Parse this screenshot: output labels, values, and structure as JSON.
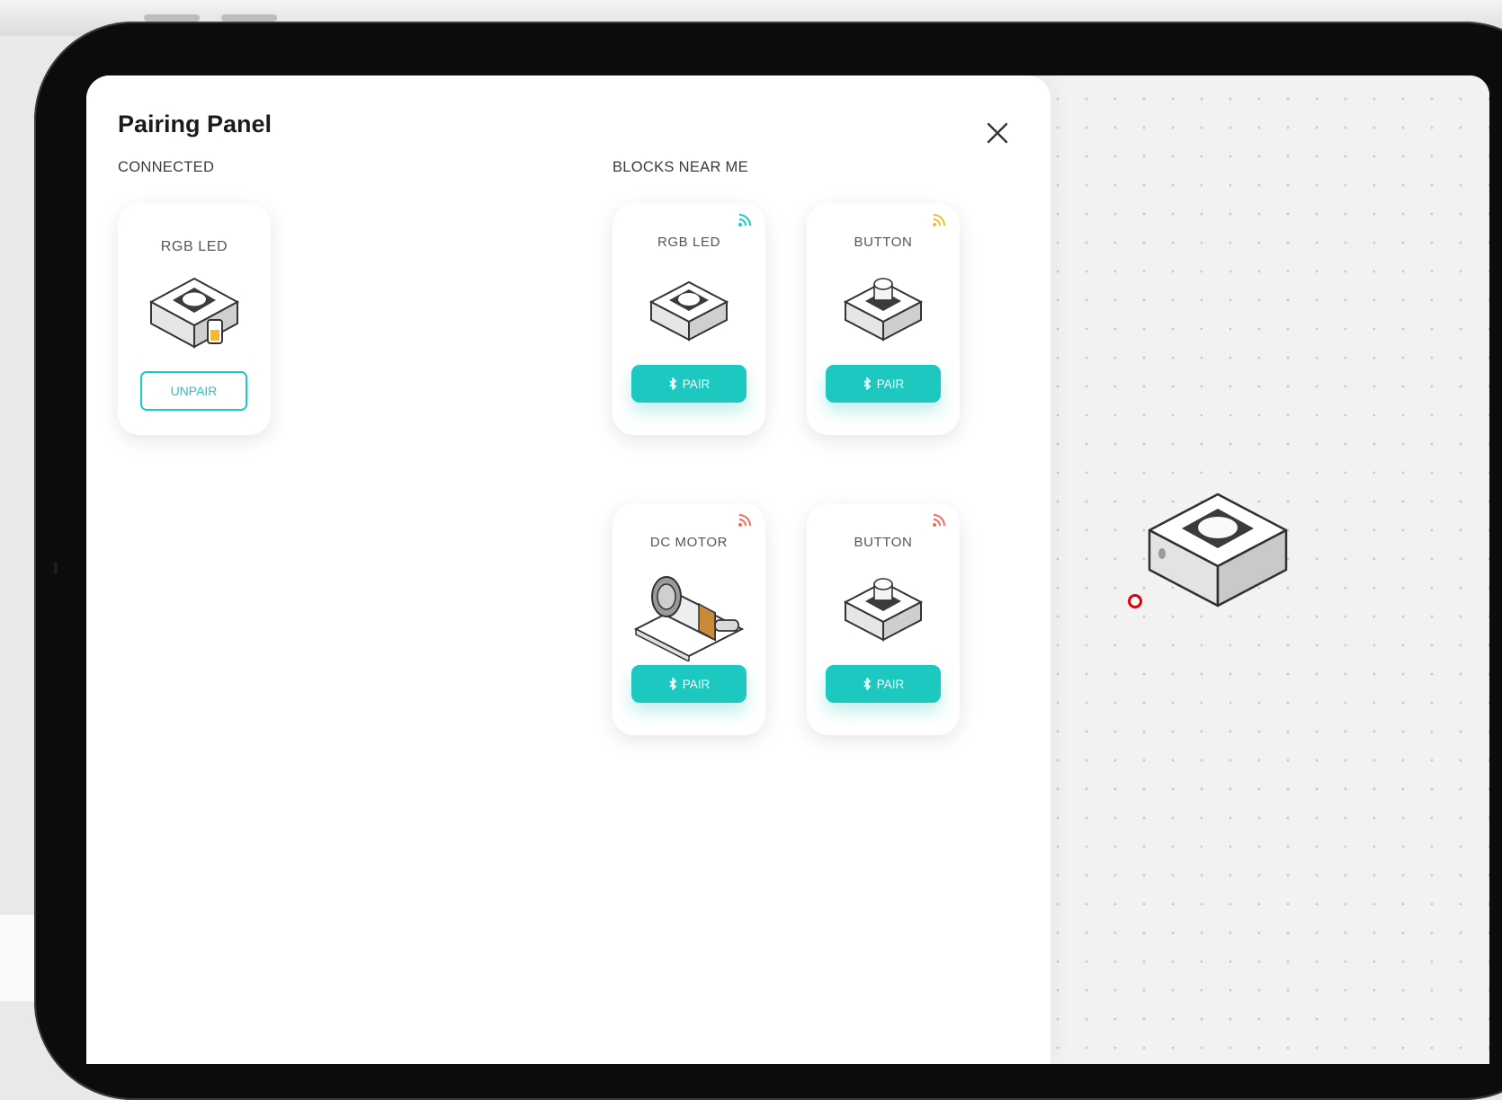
{
  "panel": {
    "title": "Pairing Panel",
    "close_icon": "close-icon"
  },
  "connected": {
    "label": "CONNECTED",
    "cards": [
      {
        "name": "RGB LED",
        "button_label": "UNPAIR",
        "status_icon": "battery-icon"
      }
    ]
  },
  "nearby": {
    "label": "BLOCKS NEAR ME",
    "cards": [
      {
        "name": "RGB LED",
        "button_label": "PAIR",
        "signal_color": "#1dc8c0",
        "signal_icon": "wifi-signal-icon"
      },
      {
        "name": "BUTTON",
        "button_label": "PAIR",
        "signal_color": "#f5b833",
        "signal_icon": "wifi-signal-icon"
      },
      {
        "name": "DC MOTOR",
        "button_label": "PAIR",
        "signal_color": "#f26a5a",
        "signal_icon": "wifi-signal-icon"
      },
      {
        "name": "BUTTON",
        "button_label": "PAIR",
        "signal_color": "#f26a5a",
        "signal_icon": "wifi-signal-icon"
      }
    ]
  },
  "colors": {
    "accent": "#1dc8c0",
    "port": "#e00000"
  }
}
